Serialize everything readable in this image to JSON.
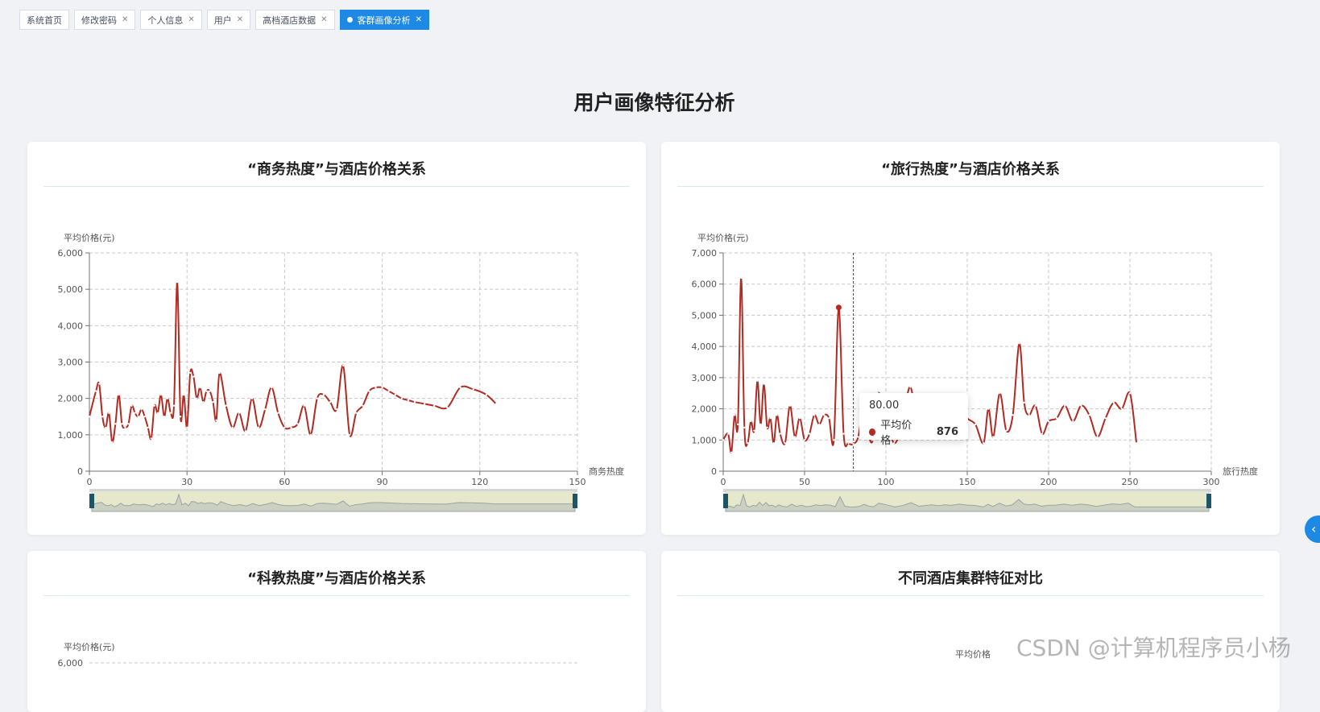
{
  "tabs": [
    {
      "label": "系统首页",
      "closable": false,
      "active": false
    },
    {
      "label": "修改密码",
      "closable": true,
      "active": false
    },
    {
      "label": "个人信息",
      "closable": true,
      "active": false
    },
    {
      "label": "用户",
      "closable": true,
      "active": false
    },
    {
      "label": "高档酒店数据",
      "closable": true,
      "active": false
    },
    {
      "label": "客群画像分析",
      "closable": true,
      "active": true
    }
  ],
  "page_title": "用户画像特征分析",
  "cards": {
    "business": {
      "title": "“商务热度”与酒店价格关系"
    },
    "travel": {
      "title": "“旅行热度”与酒店价格关系"
    },
    "science": {
      "title": "“科教热度”与酒店价格关系"
    },
    "cluster": {
      "title": "不同酒店集群特征对比"
    }
  },
  "tooltip": {
    "x_value": "80.00",
    "series": "平均价格",
    "value": "876"
  },
  "watermark": "CSDN @计算机程序员小杨",
  "colors": {
    "line": "#b22a22",
    "accent": "#1e88e5",
    "zoom_fill": "#e6e8cc",
    "zoom_handle": "#1b5566"
  },
  "chart_data": [
    {
      "type": "line",
      "title": "“商务热度”与酒店价格关系",
      "xlabel": "商务热度",
      "ylabel": "平均价格(元)",
      "xlim": [
        0,
        150
      ],
      "ylim": [
        0,
        6000
      ],
      "xticks": [
        0,
        30,
        60,
        90,
        120,
        150
      ],
      "yticks": [
        0,
        1000,
        2000,
        3000,
        4000,
        5000,
        6000
      ],
      "xtick_labels": [
        "0",
        "30",
        "60",
        "90",
        "120",
        "150"
      ],
      "ytick_labels": [
        "0",
        "1,000",
        "2,000",
        "3,000",
        "4,000",
        "5,000",
        "6,000"
      ],
      "grid": true,
      "series": [
        {
          "x": [
            0,
            2,
            3,
            4,
            5,
            6,
            7,
            8,
            9,
            10,
            11,
            12,
            13,
            14,
            15,
            16,
            17,
            18,
            19,
            20,
            21,
            22,
            23,
            24,
            25,
            26,
            27,
            28,
            29,
            30,
            31,
            32,
            33,
            34,
            35,
            36,
            37,
            38,
            39,
            40,
            42,
            44,
            46,
            48,
            50,
            52,
            54,
            56,
            58,
            60,
            62,
            64,
            66,
            68,
            70,
            72,
            74,
            76,
            78,
            80,
            82,
            84,
            86,
            88,
            90,
            92,
            94,
            96,
            98,
            100,
            103,
            106,
            110,
            114,
            118,
            122,
            125
          ],
          "y": [
            1500,
            2200,
            2400,
            1500,
            1200,
            1600,
            800,
            1300,
            2100,
            1300,
            1200,
            1300,
            1800,
            1600,
            1500,
            1700,
            1500,
            1200,
            900,
            1800,
            1600,
            2100,
            1500,
            2000,
            1600,
            1800,
            5200,
            1500,
            2100,
            1200,
            2700,
            2600,
            2000,
            2300,
            1900,
            2200,
            2200,
            1900,
            1400,
            2700,
            1800,
            1200,
            1600,
            1100,
            2000,
            1200,
            1700,
            2300,
            1600,
            1200,
            1200,
            1300,
            1800,
            1000,
            2000,
            2100,
            1900,
            1700,
            2900,
            1000,
            1600,
            1800,
            2200,
            2300,
            2300,
            2200,
            2100,
            2000,
            1950,
            1900,
            1850,
            1800,
            1750,
            2300,
            2250,
            2100,
            1850
          ]
        }
      ]
    },
    {
      "type": "line",
      "title": "“旅行热度”与酒店价格关系",
      "xlabel": "旅行热度",
      "ylabel": "平均价格(元)",
      "xlim": [
        0,
        300
      ],
      "ylim": [
        0,
        7000
      ],
      "xticks": [
        0,
        50,
        100,
        150,
        200,
        250,
        300
      ],
      "yticks": [
        0,
        1000,
        2000,
        3000,
        4000,
        5000,
        6000,
        7000
      ],
      "xtick_labels": [
        "0",
        "50",
        "100",
        "150",
        "200",
        "250",
        "300"
      ],
      "ytick_labels": [
        "0",
        "1,000",
        "2,000",
        "3,000",
        "4,000",
        "5,000",
        "6,000",
        "7,000"
      ],
      "grid": true,
      "series": [
        {
          "name": "平均价格",
          "x": [
            0,
            3,
            5,
            7,
            9,
            11,
            13,
            15,
            17,
            19,
            21,
            23,
            25,
            27,
            29,
            31,
            33,
            35,
            38,
            41,
            44,
            47,
            50,
            53,
            56,
            59,
            62,
            65,
            68,
            71,
            74,
            77,
            80,
            83,
            86,
            89,
            92,
            95,
            100,
            105,
            110,
            115,
            120,
            124,
            128,
            132,
            136,
            140,
            145,
            150,
            155,
            160,
            163,
            166,
            170,
            174,
            178,
            182,
            185,
            188,
            192,
            196,
            200,
            205,
            210,
            215,
            220,
            225,
            230,
            235,
            240,
            245,
            250,
            254
          ],
          "y": [
            1000,
            1200,
            600,
            1800,
            1500,
            6200,
            1400,
            900,
            1600,
            1300,
            2900,
            1500,
            2800,
            1400,
            1700,
            900,
            1800,
            1200,
            900,
            2100,
            1100,
            1700,
            1000,
            1200,
            1800,
            1500,
            1800,
            1700,
            1000,
            5250,
            1200,
            900,
            876,
            1100,
            2000,
            1200,
            1000,
            2500,
            1800,
            900,
            1500,
            2700,
            1200,
            1500,
            1800,
            1400,
            1800,
            1600,
            2100,
            1700,
            1500,
            900,
            2000,
            1100,
            2500,
            1300,
            1800,
            4100,
            2200,
            1800,
            2100,
            1200,
            1600,
            1700,
            2100,
            1600,
            2100,
            1800,
            1100,
            1700,
            2200,
            2000,
            2500,
            900
          ]
        }
      ],
      "tooltip_x": 80,
      "tooltip_value": 876,
      "cursor_x": 80
    },
    {
      "type": "line",
      "title": "“科教热度”与酒店价格关系",
      "ylabel": "平均价格(元)",
      "ylim": [
        0,
        6000
      ],
      "ytick_labels": [
        "6,000"
      ],
      "series": []
    },
    {
      "type": "bar",
      "title": "不同酒店集群特征对比",
      "ylabel": "平均价格",
      "series": []
    }
  ]
}
